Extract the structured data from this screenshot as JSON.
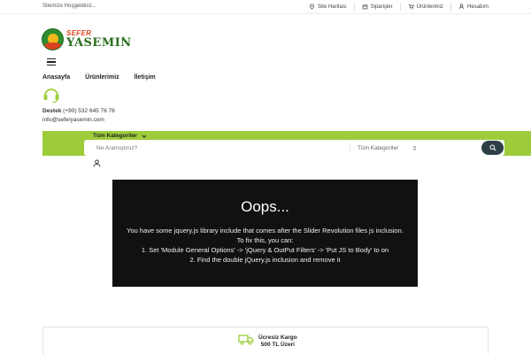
{
  "topbar": {
    "welcome": "Sitemize Hoşgeldiniz...",
    "links": [
      {
        "label": "Site Haritası",
        "icon": "location-pin-icon"
      },
      {
        "label": "Siparişler",
        "icon": "box-icon"
      },
      {
        "label": "Ürünlerimiz",
        "icon": "cart-icon"
      },
      {
        "label": "Hesabım",
        "icon": "user-icon"
      }
    ]
  },
  "logo": {
    "brand_top": "SEFER",
    "brand_main": "YASEMIN",
    "reg": "®"
  },
  "nav": {
    "items": [
      "Anasayfa",
      "Ürünlerimiz",
      "İletişim"
    ]
  },
  "support": {
    "label": "Destek",
    "phone": "(+90) 532 645 76 76",
    "email": "info@seferyasemin.com"
  },
  "search": {
    "categories_toggle": "Tüm Kategoriler",
    "placeholder": "Ne Aramıştınız?",
    "category_select": "Tüm Kategoriler"
  },
  "slider": {
    "title": "Oops...",
    "lines": [
      "You have some jquery.js library include that comes after the Slider Revolution files js inclusion.",
      "To fix this, you can:",
      "1. Set 'Module General Options' -> 'jQuery & OutPut Filters' -> 'Put JS to Body' to on",
      "2. Find the double jQuery.js inclusion and remove it"
    ]
  },
  "shipping": {
    "line1": "Ücresiz Kargo",
    "line2": "500 TL Üzeri"
  },
  "colors": {
    "accent_green": "#9dcc3b",
    "search_button": "#2f3f47",
    "slider_bg": "#111111"
  }
}
